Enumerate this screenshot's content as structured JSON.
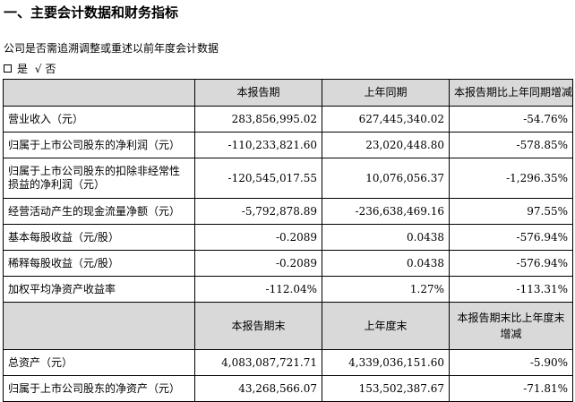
{
  "heading": "一、主要会计数据和财务指标",
  "question": "公司是否需追溯调整或重述以前年度会计数据",
  "answer": {
    "yes": "是",
    "check": "√",
    "no": "否"
  },
  "table1": {
    "headers": [
      "",
      "本报告期",
      "上年同期",
      "本报告期比上年同期增减"
    ],
    "rows": [
      {
        "label": "营业收入（元）",
        "current": "283,856,995.02",
        "prior": "627,445,340.02",
        "change": "-54.76%"
      },
      {
        "label": "归属于上市公司股东的净利润（元）",
        "current": "-110,233,821.60",
        "prior": "23,020,448.80",
        "change": "-578.85%"
      },
      {
        "label": "归属于上市公司股东的扣除非经常性损益的净利润（元）",
        "current": "-120,545,017.55",
        "prior": "10,076,056.37",
        "change": "-1,296.35%"
      },
      {
        "label": "经营活动产生的现金流量净额（元）",
        "current": "-5,792,878.89",
        "prior": "-236,638,469.16",
        "change": "97.55%"
      },
      {
        "label": "基本每股收益（元/股）",
        "current": "-0.2089",
        "prior": "0.0438",
        "change": "-576.94%"
      },
      {
        "label": "稀释每股收益（元/股）",
        "current": "-0.2089",
        "prior": "0.0438",
        "change": "-576.94%"
      },
      {
        "label": "加权平均净资产收益率",
        "current": "-112.04%",
        "prior": "1.27%",
        "change": "-113.31%"
      }
    ]
  },
  "table2": {
    "headers": [
      "",
      "本报告期末",
      "上年度末",
      "本报告期末比上年度末增减"
    ],
    "rows": [
      {
        "label": "总资产（元）",
        "current": "4,083,087,721.71",
        "prior": "4,339,036,151.60",
        "change": "-5.90%"
      },
      {
        "label": "归属于上市公司股东的净资产（元）",
        "current": "43,268,566.07",
        "prior": "153,502,387.67",
        "change": "-71.81%"
      }
    ]
  }
}
